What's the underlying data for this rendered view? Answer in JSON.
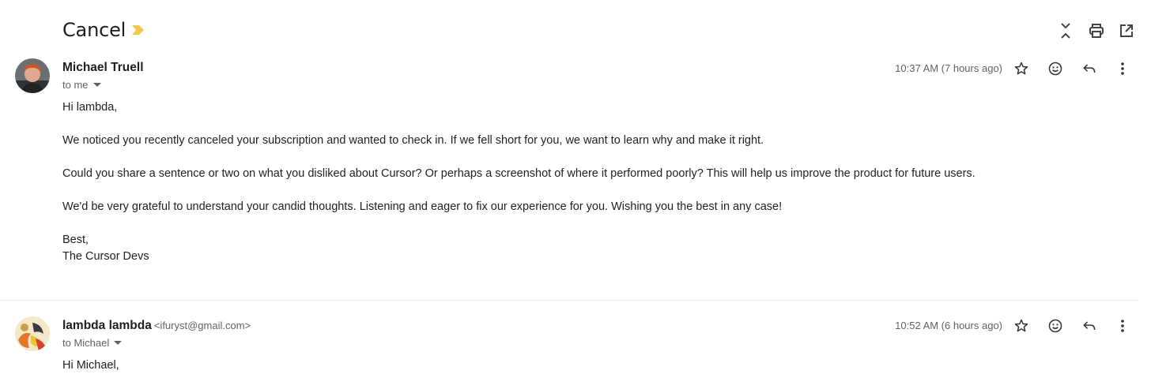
{
  "thread": {
    "subject": "Cancel",
    "label_color": "#f2c94c"
  },
  "toolbar": {
    "collapse_icon": "collapse-all-icon",
    "print_icon": "print-icon",
    "open_new_window_icon": "open-in-new-window-icon"
  },
  "messages": [
    {
      "sender_name": "Michael Truell",
      "sender_email": "",
      "to": "to me",
      "time": "10:37 AM (7 hours ago)",
      "paragraphs": [
        "Hi lambda,",
        "We noticed you recently canceled your subscription and wanted to check in. If we fell short for you, we want to learn why and make it right.",
        "Could you share a sentence or two on what you disliked about Cursor? Or perhaps a screenshot of where it performed poorly? This will help us improve the product for future users.",
        "We'd be very grateful to understand your candid thoughts. Listening and eager to fix our experience for you. Wishing you the best in any case!"
      ],
      "signoff_1": "Best,",
      "signoff_2": "The Cursor Devs"
    },
    {
      "sender_name": "lambda lambda",
      "sender_email": "<ifuryst@gmail.com>",
      "to": "to Michael",
      "time": "10:52 AM (6 hours ago)",
      "paragraphs": [
        "Hi Michael,"
      ]
    }
  ]
}
